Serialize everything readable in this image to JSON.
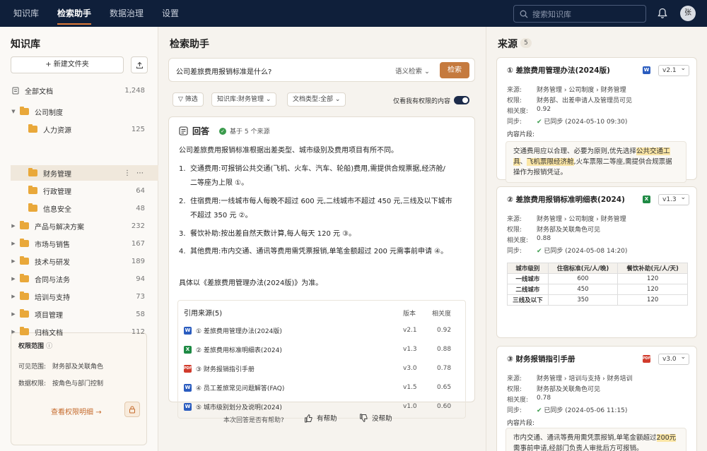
{
  "nav": {
    "tabs": [
      "知识库",
      "检索助手",
      "数据治理",
      "设置"
    ],
    "active_tab": "检索助手",
    "search_placeholder": "搜索知识库",
    "avatar": "张"
  },
  "sidebar": {
    "title": "知识库",
    "new_folder": "新建文件夹",
    "all_docs": {
      "label": "全部文档",
      "count": "1,248"
    },
    "items": [
      {
        "label": "公司制度",
        "count": "",
        "expanded": true,
        "level": 0
      },
      {
        "label": "人力资源",
        "count": "125",
        "level": 1
      },
      {
        "label": "财务管理",
        "count": "",
        "level": 1,
        "selected": true
      },
      {
        "label": "行政管理",
        "count": "64",
        "level": 1
      },
      {
        "label": "信息安全",
        "count": "48",
        "level": 1
      },
      {
        "label": "产品与解决方案",
        "count": "232",
        "level": 0
      },
      {
        "label": "市场与销售",
        "count": "167",
        "level": 0
      },
      {
        "label": "技术与研发",
        "count": "189",
        "level": 0
      },
      {
        "label": "合同与法务",
        "count": "94",
        "level": 0
      },
      {
        "label": "培训与支持",
        "count": "73",
        "level": 0
      },
      {
        "label": "项目管理",
        "count": "58",
        "level": 0
      },
      {
        "label": "归档文档",
        "count": "112",
        "level": 0
      }
    ],
    "permission": {
      "title": "权限范围",
      "visible_label": "可见范围:",
      "visible_value": "财务部及关联角色",
      "data_label": "数据权限:",
      "data_value": "按角色与部门控制",
      "link": "查看权限明细"
    }
  },
  "main": {
    "title": "检索助手",
    "query": "公司差旅费用报销标准是什么?",
    "mode": "语义检索",
    "search_button": "检索",
    "filters": {
      "filter_label": "筛选",
      "kb": "知识库:财务管理",
      "doctype": "文档类型:全部",
      "only_mine": "仅看我有权限的内容"
    },
    "answer": {
      "title": "回答",
      "badge": "基于 5 个来源",
      "intro": "公司差旅费用报销标准根据出差类型、城市级别及费用项目有所不同。",
      "points": [
        {
          "n": "1.",
          "lines": [
            "交通费用:可报销公共交通(飞机、火车、汽车、轮船)费用,需提供合规票据,经济舱/",
            "二等座为上限 ①。"
          ]
        },
        {
          "n": "2.",
          "lines": [
            "住宿费用:一线城市每人每晚不超过 600 元,二线城市不超过 450 元,三线及以下城市",
            "不超过 350 元 ②。"
          ]
        },
        {
          "n": "3.",
          "lines": [
            "餐饮补助:按出差自然天数计算,每人每天 120 元 ③。"
          ]
        },
        {
          "n": "4.",
          "lines": [
            "其他费用:市内交通、通讯等费用需凭票报销,单笔金额超过 200 元需事前申请 ④。"
          ]
        }
      ],
      "conclusion": "具体以《差旅费用管理办法(2024版)》为准。",
      "citations": {
        "title": "引用来源(5)",
        "col_version": "版本",
        "col_relevance": "相关度",
        "rows": [
          {
            "type": "W",
            "name": "① 差旅费用管理办法(2024版)",
            "version": "v2.1",
            "relevance": "0.92"
          },
          {
            "type": "X",
            "name": "② 差旅费用标准明细表(2024)",
            "version": "v1.3",
            "relevance": "0.88"
          },
          {
            "type": "PDF",
            "name": "③ 财务报销指引手册",
            "version": "v3.0",
            "relevance": "0.78"
          },
          {
            "type": "W",
            "name": "④ 员工差旅常见问题解答(FAQ)",
            "version": "v1.5",
            "relevance": "0.65"
          },
          {
            "type": "W",
            "name": "⑤ 城市级别划分及说明(2024)",
            "version": "v1.0",
            "relevance": "0.60"
          }
        ]
      }
    },
    "feedback": {
      "question": "本次回答是否有帮助?",
      "yes": "有帮助",
      "no": "没帮助"
    }
  },
  "sources": {
    "title": "来源",
    "count": "5",
    "labels": {
      "source": "来源:",
      "perm": "权限:",
      "rel": "相关度:",
      "sync": "同步:",
      "snippet": "内容片段:"
    },
    "cards": [
      {
        "title": "① 差旅费用管理办法(2024版)",
        "type": "W",
        "version": "v2.1",
        "source": "财务管理 › 公司制度 › 财务管理",
        "perm": "财务部、出差申请人及管理员可见",
        "rel": "0.92",
        "sync": "已同步 (2024-05-10 09:30)",
        "snippet_parts": [
          "交通费用应以合理、必要为原则,优先选择",
          "公共交通工具",
          "、",
          "飞机票限经济舱",
          ",火车票限二等座,需提供合规票据操作为报销凭证。"
        ]
      },
      {
        "title": "② 差旅费用报销标准明细表(2024)",
        "type": "X",
        "version": "v1.3",
        "source": "财务管理 › 公司制度 › 财务管理",
        "perm": "财务部及关联角色可见",
        "rel": "0.88",
        "sync": "已同步 (2024-05-08 14:20)",
        "table": {
          "headers": [
            "城市级别",
            "住宿标准(元/人/晚)",
            "餐饮补助(元/人/天)"
          ],
          "rows": [
            [
              "一线城市",
              "600",
              "120"
            ],
            [
              "二线城市",
              "450",
              "120"
            ],
            [
              "三线及以下",
              "350",
              "120"
            ]
          ]
        }
      },
      {
        "title": "③ 财务报销指引手册",
        "type": "PDF",
        "version": "v3.0",
        "source": "财务管理 › 培训与支持 › 财务培训",
        "perm": "财务部及关联角色可见",
        "rel": "0.78",
        "sync": "已同步 (2024-05-06 11:15)",
        "snippet_parts": [
          "市内交通、通讯等费用需凭票报销,单笔金额超过",
          "200元",
          "需事前申请,经部门负责人审批后方可报销。"
        ]
      }
    ]
  }
}
